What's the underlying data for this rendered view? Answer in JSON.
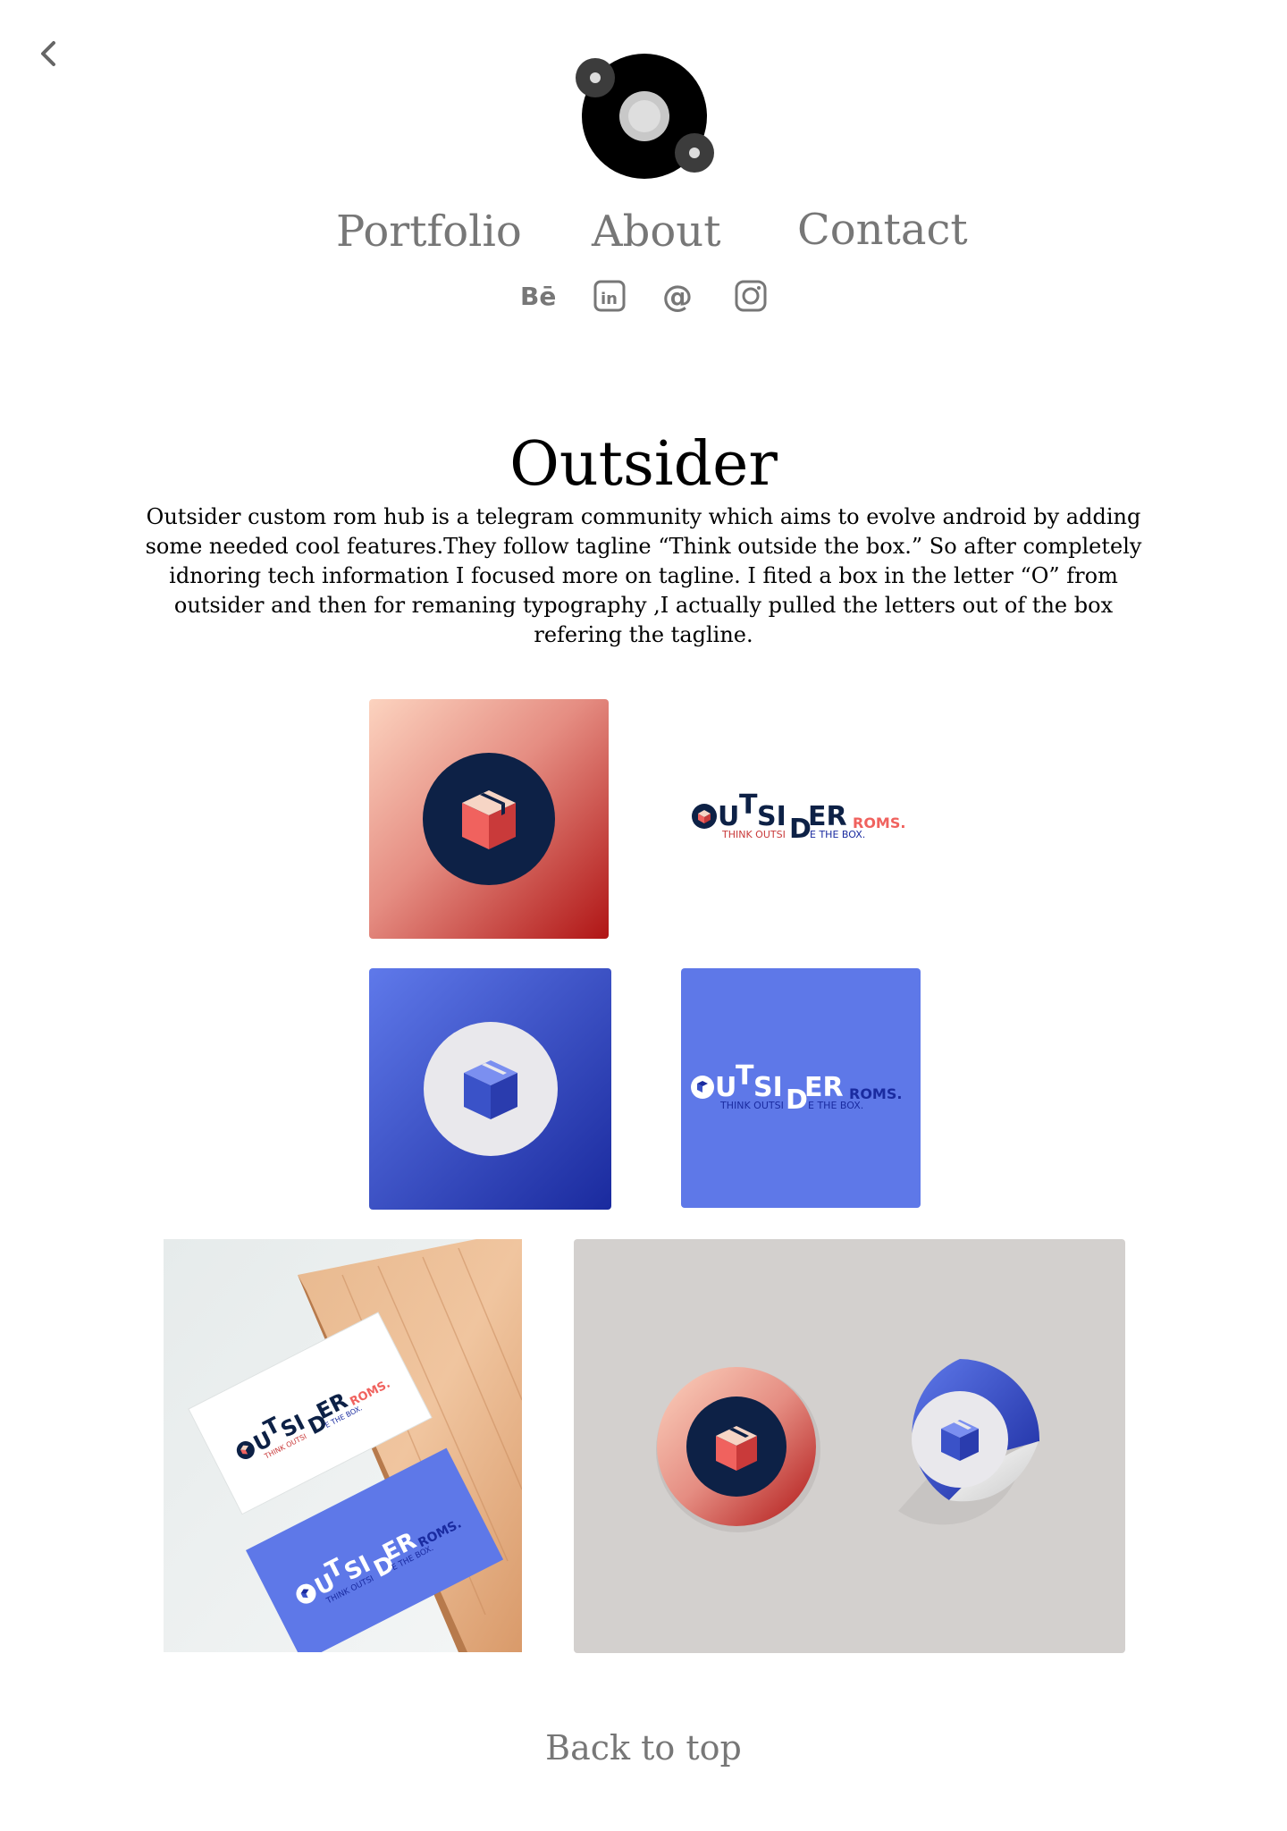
{
  "nav": {
    "back_icon": "chevron-left-icon",
    "logo_icon": "orbit-logo-icon",
    "items": [
      {
        "label": "Portfolio"
      },
      {
        "label": "About"
      },
      {
        "label": "Contact"
      }
    ]
  },
  "socials": [
    {
      "icon": "behance-icon"
    },
    {
      "icon": "linkedin-icon"
    },
    {
      "icon": "email-at-icon"
    },
    {
      "icon": "instagram-icon"
    }
  ],
  "project": {
    "title": "Outsider",
    "description": "Outsider custom rom hub is a telegram community which aims to evolve android by adding some needed cool features.They follow tagline “Think outside the box.” So after completely idnoring tech information I focused more on tagline. I fited a box in the letter “O” from outsider and then for remaning typography ,I actually pulled the letters out of the box refering the tagline."
  },
  "logo_art": {
    "word_parts": [
      "O",
      "U",
      "T",
      "SI",
      "D",
      "ER"
    ],
    "suffix": "ROMS.",
    "tagline_start": "THINK OUTSI",
    "tagline_end": "E THE BOX."
  },
  "footer": {
    "back_to_top": "Back to top"
  },
  "colors": {
    "nav_text": "#777777",
    "navy": "#0d2146",
    "coral": "#f0625e",
    "brand_blue": "#5e78e8",
    "deep_blue": "#1a2ba0",
    "sticker_bg": "#d3d0ce"
  }
}
